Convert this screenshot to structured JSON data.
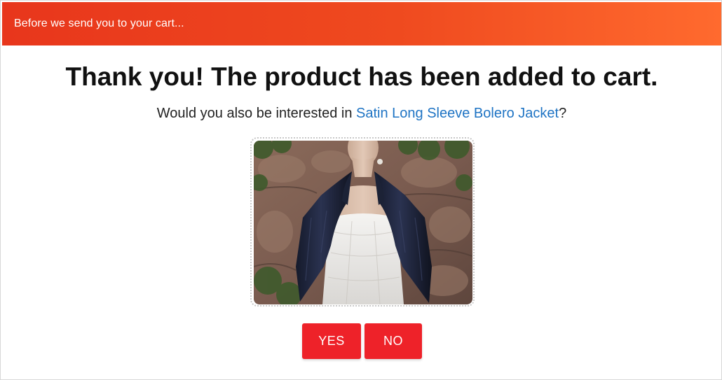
{
  "banner": {
    "text": "Before we send you to your cart..."
  },
  "headline": "Thank you! The product has been added to cart.",
  "offer": {
    "prefix": "Would you also be interested in ",
    "product_name": "Satin Long Sleeve Bolero Jacket",
    "suffix": "?"
  },
  "product_image": {
    "alt": "Satin Long Sleeve Bolero Jacket"
  },
  "actions": {
    "yes_label": "YES",
    "no_label": "NO"
  },
  "colors": {
    "banner_start": "#e8361c",
    "banner_end": "#ff6a2e",
    "button": "#ee2229",
    "link": "#1f74c4"
  }
}
